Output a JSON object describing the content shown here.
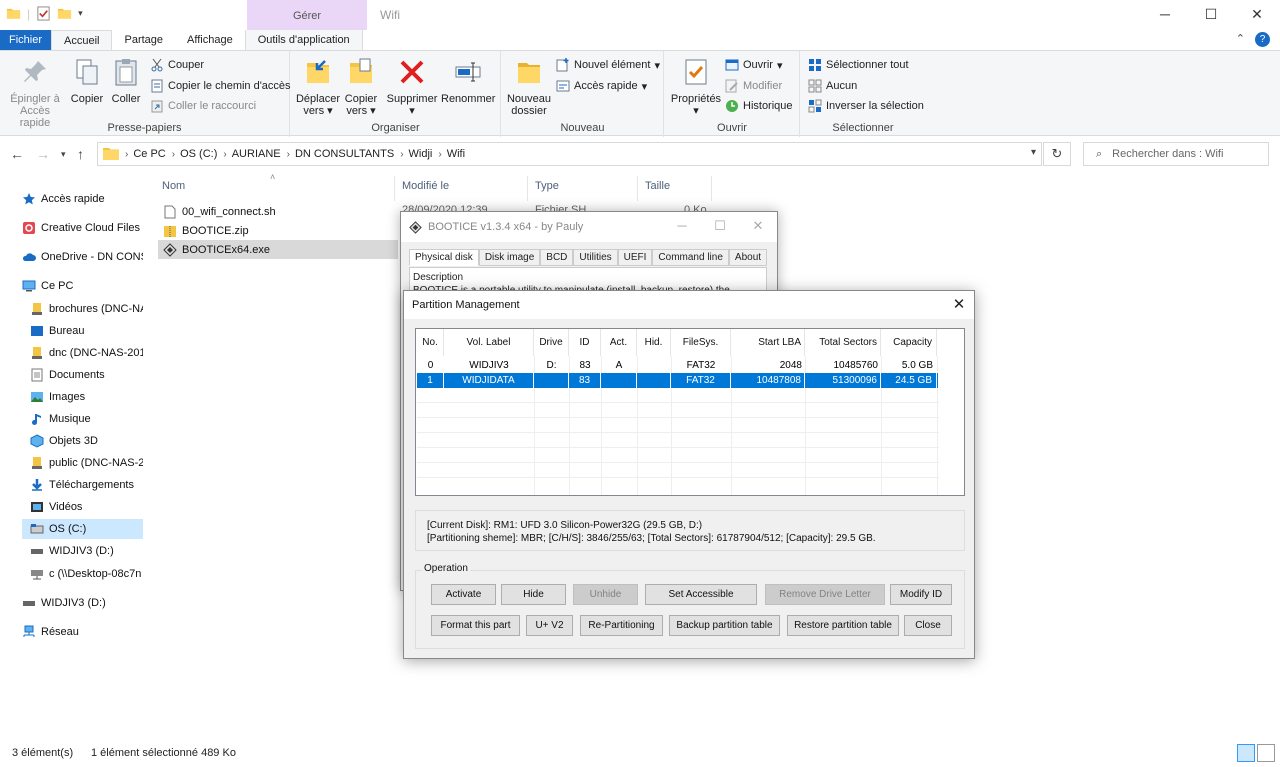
{
  "window": {
    "title": "Wifi",
    "context_header": "Gérer"
  },
  "ribbon_tabs": {
    "file": "Fichier",
    "home": "Accueil",
    "share": "Partage",
    "view": "Affichage",
    "app_tools": "Outils d'application"
  },
  "ribbon": {
    "clipboard": {
      "name": "Presse-papiers",
      "pin_line1": "Épingler à",
      "pin_line2": "Accès rapide",
      "copy": "Copier",
      "paste": "Coller",
      "cut": "Couper",
      "copy_path": "Copier le chemin d'accès",
      "paste_shortcut": "Coller le raccourci"
    },
    "organize": {
      "name": "Organiser",
      "move_line1": "Déplacer",
      "move_line2": "vers",
      "copy_line1": "Copier",
      "copy_line2": "vers",
      "delete": "Supprimer",
      "rename": "Renommer"
    },
    "new": {
      "name": "Nouveau",
      "new_folder_line1": "Nouveau",
      "new_folder_line2": "dossier",
      "new_item": "Nouvel élément",
      "quick_access": "Accès rapide"
    },
    "open": {
      "name": "Ouvrir",
      "properties": "Propriétés",
      "open": "Ouvrir",
      "edit": "Modifier",
      "history": "Historique"
    },
    "select": {
      "name": "Sélectionner",
      "select_all": "Sélectionner tout",
      "select_none": "Aucun",
      "invert": "Inverser la sélection"
    }
  },
  "address": {
    "crumbs": [
      "Ce PC",
      "OS (C:)",
      "AURIANE",
      "DN CONSULTANTS",
      "Widji",
      "Wifi"
    ],
    "search_placeholder": "Rechercher dans : Wifi"
  },
  "nav": {
    "quick_access": "Accès rapide",
    "creative_cloud": "Creative Cloud Files",
    "onedrive": "OneDrive - DN CONS",
    "this_pc": "Ce PC",
    "items": [
      "brochures (DNC-NA",
      "Bureau",
      "dnc (DNC-NAS-201",
      "Documents",
      "Images",
      "Musique",
      "Objets 3D",
      "public (DNC-NAS-2",
      "Téléchargements",
      "Vidéos",
      "OS (C:)",
      "WIDJIV3 (D:)",
      "c (\\\\Desktop-08c7n"
    ],
    "widjiv3": "WIDJIV3 (D:)",
    "network": "Réseau"
  },
  "files": {
    "columns": [
      "Nom",
      "Modifié le",
      "Type",
      "Taille"
    ],
    "rows": [
      {
        "name": "00_wifi_connect.sh",
        "date": "28/09/2020 12:39",
        "type": "Fichier SH",
        "size": "0 Ko"
      },
      {
        "name": "BOOTICE.zip"
      },
      {
        "name": "BOOTICEx64.exe"
      }
    ]
  },
  "status": {
    "count": "3 élément(s)",
    "selection": "1 élément sélectionné  489 Ko"
  },
  "bootice": {
    "title": "BOOTICE v1.3.4 x64 - by Pauly",
    "tabs": [
      "Physical disk",
      "Disk image",
      "BCD",
      "Utilities",
      "UEFI",
      "Command line",
      "About"
    ],
    "description_label": "Description",
    "description_text": "BOOTICE is a portable utility to manipulate (install, backup, restore) the"
  },
  "partition_dialog": {
    "title": "Partition Management",
    "columns": [
      "No.",
      "Vol. Label",
      "Drive",
      "ID",
      "Act.",
      "Hid.",
      "FileSys.",
      "Start LBA",
      "Total Sectors",
      "Capacity"
    ],
    "rows": [
      {
        "no": "0",
        "label": "WIDJIV3",
        "drive": "D:",
        "id": "83",
        "act": "A",
        "hid": "",
        "fs": "FAT32",
        "start": "2048",
        "total": "10485760",
        "capacity": "5.0 GB"
      },
      {
        "no": "1",
        "label": "WIDJIDATA",
        "drive": "",
        "id": "83",
        "act": "",
        "hid": "",
        "fs": "FAT32",
        "start": "10487808",
        "total": "51300096",
        "capacity": "24.5 GB"
      }
    ],
    "info_line1": "[Current Disk]:   RM1: UFD 3.0 Silicon-Power32G (29.5 GB, D:)",
    "info_line2": "[Partitioning sheme]:    MBR;     [C/H/S]: 3846/255/63; [Total Sectors]: 61787904/512; [Capacity]: 29.5 GB.",
    "operation_label": "Operation",
    "buttons": {
      "activate": "Activate",
      "hide": "Hide",
      "unhide": "Unhide",
      "set_accessible": "Set Accessible",
      "remove_letter": "Remove Drive Letter",
      "modify_id": "Modify ID",
      "format": "Format this part",
      "uv2": "U+ V2",
      "repartition": "Re-Partitioning",
      "backup": "Backup partition table",
      "restore": "Restore partition table",
      "close": "Close"
    }
  },
  "colors": {
    "accent": "#0078d7",
    "file_tab": "#1a6bc6",
    "context_tab": "#ead7f7",
    "selection": "#cce8ff"
  }
}
